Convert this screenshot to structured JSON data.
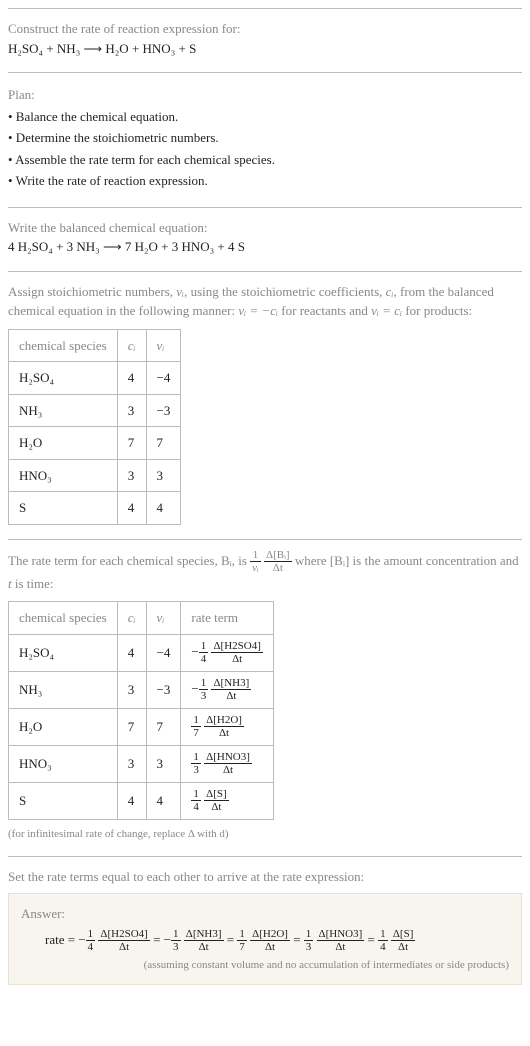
{
  "top": {
    "prompt_line1": "Construct the rate of reaction expression for:",
    "eq_h2so4": "H₂SO₄",
    "eq_plus1": " + ",
    "eq_nh3": "NH₃",
    "eq_arrow": " ⟶ ",
    "eq_h2o": "H₂O",
    "eq_plus2": " + ",
    "eq_hno3": "HNO₃",
    "eq_plus3": " + ",
    "eq_s": "S"
  },
  "plan": {
    "label": "Plan:",
    "b1": "• Balance the chemical equation.",
    "b2": "• Determine the stoichiometric numbers.",
    "b3": "• Assemble the rate term for each chemical species.",
    "b4": "• Write the rate of reaction expression."
  },
  "balanced": {
    "intro": "Write the balanced chemical equation:",
    "eq": "4 H₂SO₄ + 3 NH₃ ⟶ 7 H₂O + 3 HNO₃ + 4 S"
  },
  "stoich": {
    "intro_a": "Assign stoichiometric numbers, ",
    "nu_i": "νᵢ",
    "intro_b": ", using the stoichiometric coefficients, ",
    "c_i": "cᵢ",
    "intro_c": ", from the balanced chemical equation in the following manner: ",
    "rel_reac": "νᵢ = −cᵢ",
    "intro_d": " for reactants and ",
    "rel_prod": "νᵢ = cᵢ",
    "intro_e": " for products:",
    "h_species": "chemical species",
    "h_ci": "cᵢ",
    "h_nu": "νᵢ",
    "rows": [
      {
        "s": "H₂SO₄",
        "c": "4",
        "n": "−4"
      },
      {
        "s": "NH₃",
        "c": "3",
        "n": "−3"
      },
      {
        "s": "H₂O",
        "c": "7",
        "n": "7"
      },
      {
        "s": "HNO₃",
        "c": "3",
        "n": "3"
      },
      {
        "s": "S",
        "c": "4",
        "n": "4"
      }
    ]
  },
  "rate_term": {
    "intro_a": "The rate term for each chemical species, Bᵢ, is ",
    "one": "1",
    "nu_i": "νᵢ",
    "delta_bi": "Δ[Bᵢ]",
    "delta_t": "Δt",
    "intro_b": " where [Bᵢ] is the amount concentration and ",
    "t": "t",
    "intro_c": " is time:",
    "h_species": "chemical species",
    "h_ci": "cᵢ",
    "h_nu": "νᵢ",
    "h_rate": "rate term",
    "rows": [
      {
        "s": "H₂SO₄",
        "c": "4",
        "n": "−4",
        "sign": "−",
        "fd": "4",
        "dn": "Δ[H2SO4]",
        "dt": "Δt"
      },
      {
        "s": "NH₃",
        "c": "3",
        "n": "−3",
        "sign": "−",
        "fd": "3",
        "dn": "Δ[NH3]",
        "dt": "Δt"
      },
      {
        "s": "H₂O",
        "c": "7",
        "n": "7",
        "sign": "",
        "fd": "7",
        "dn": "Δ[H2O]",
        "dt": "Δt"
      },
      {
        "s": "HNO₃",
        "c": "3",
        "n": "3",
        "sign": "",
        "fd": "3",
        "dn": "Δ[HNO3]",
        "dt": "Δt"
      },
      {
        "s": "S",
        "c": "4",
        "n": "4",
        "sign": "",
        "fd": "4",
        "dn": "Δ[S]",
        "dt": "Δt"
      }
    ],
    "footnote": "(for infinitesimal rate of change, replace Δ with d)"
  },
  "final": {
    "intro": "Set the rate terms equal to each other to arrive at the rate expression:",
    "answer_label": "Answer:",
    "rate_lead": "rate = ",
    "terms": [
      {
        "sign": "−",
        "fd": "4",
        "dn": "Δ[H2SO4]",
        "dt": "Δt",
        "eq": " = "
      },
      {
        "sign": "−",
        "fd": "3",
        "dn": "Δ[NH3]",
        "dt": "Δt",
        "eq": " = "
      },
      {
        "sign": "",
        "fd": "7",
        "dn": "Δ[H2O]",
        "dt": "Δt",
        "eq": " = "
      },
      {
        "sign": "",
        "fd": "3",
        "dn": "Δ[HNO3]",
        "dt": "Δt",
        "eq": " = "
      },
      {
        "sign": "",
        "fd": "4",
        "dn": "Δ[S]",
        "dt": "Δt",
        "eq": ""
      }
    ],
    "note": "(assuming constant volume and no accumulation of intermediates or side products)"
  }
}
